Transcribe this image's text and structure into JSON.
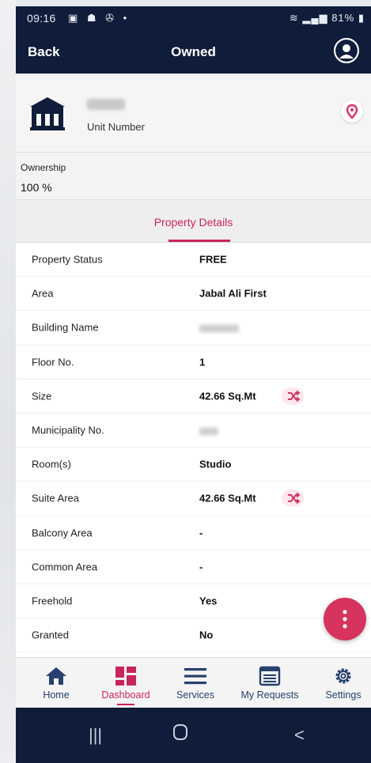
{
  "status_bar": {
    "time": "09:16",
    "left_icons": "▣ ☗ ✇ •",
    "right_text": "81%"
  },
  "header": {
    "back_label": "Back",
    "title": "Owned"
  },
  "unit": {
    "number_label": "Unit Number"
  },
  "ownership": {
    "label": "Ownership",
    "value": "100 %"
  },
  "tabs": [
    {
      "label": "Property Details",
      "active": true
    }
  ],
  "details": [
    {
      "key": "Property Status",
      "value": "FREE"
    },
    {
      "key": "Area",
      "value": "Jabal Ali First"
    },
    {
      "key": "Building Name",
      "value": ""
    },
    {
      "key": "Floor No.",
      "value": "1"
    },
    {
      "key": "Size",
      "value": "42.66 Sq.Mt"
    },
    {
      "key": "Municipality No.",
      "value": ""
    },
    {
      "key": "Room(s)",
      "value": "Studio"
    },
    {
      "key": "Suite Area",
      "value": "42.66 Sq.Mt"
    },
    {
      "key": "Balcony Area",
      "value": "-"
    },
    {
      "key": "Common Area",
      "value": "-"
    },
    {
      "key": "Freehold",
      "value": "Yes"
    },
    {
      "key": "Granted",
      "value": "No"
    }
  ],
  "bottom_nav": [
    {
      "label": "Home",
      "icon": "home-icon"
    },
    {
      "label": "Dashboard",
      "icon": "dashboard-icon",
      "active": true
    },
    {
      "label": "Services",
      "icon": "menu-icon"
    },
    {
      "label": "My Requests",
      "icon": "requests-icon"
    },
    {
      "label": "Settings",
      "icon": "gear-icon"
    }
  ],
  "colors": {
    "header_bg": "#0f1d3a",
    "accent": "#c8255a",
    "fab": "#d6345f",
    "nav_text": "#27406e"
  }
}
